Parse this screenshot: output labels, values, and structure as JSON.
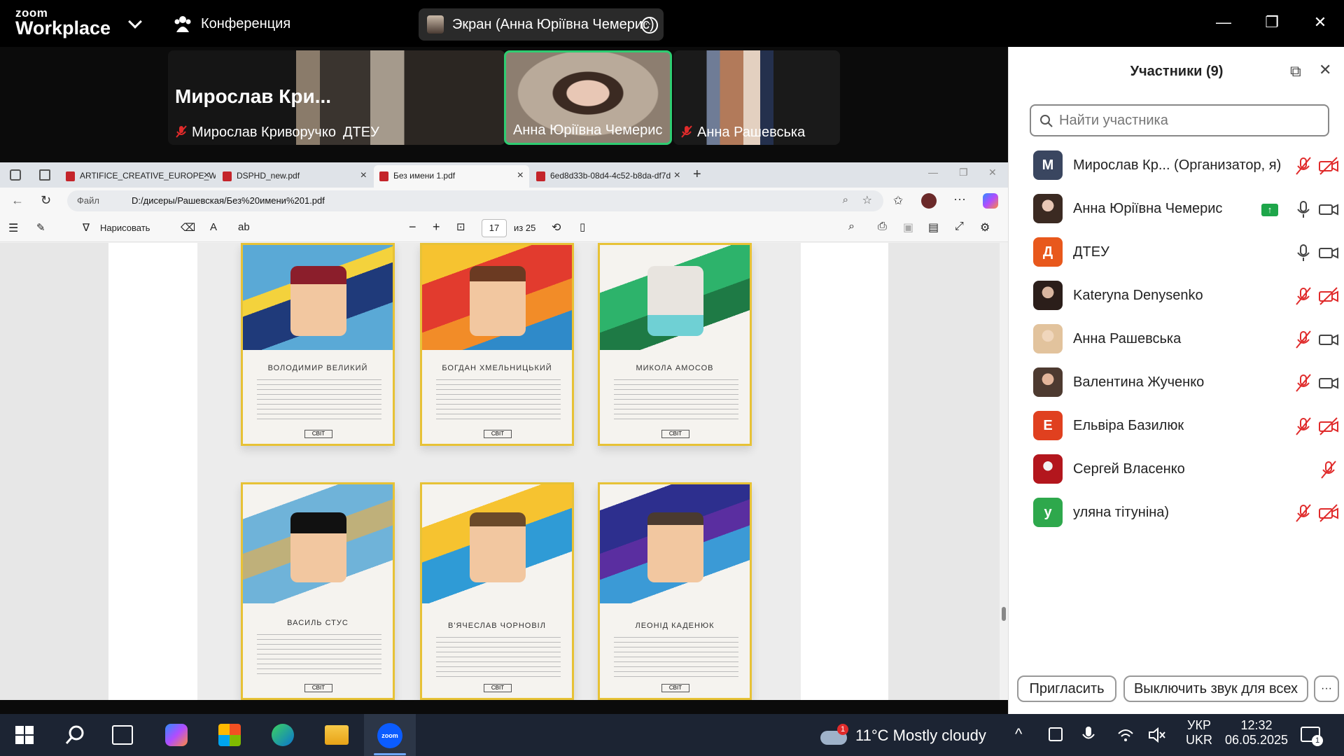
{
  "topbar": {
    "logo_small": "zoom",
    "logo_big": "Workplace",
    "conference_label": "Конференция",
    "screen_share_label": "Экран (Анна Юріївна Чемерис)"
  },
  "video_tiles": [
    {
      "name_big": "Мирослав  Кри...",
      "name": "Мирослав Криворучко"
    },
    {
      "name": "ДТЕУ"
    },
    {
      "name": "Анна Юріївна Чемерис"
    },
    {
      "name": "Анна Рашевська"
    }
  ],
  "browser": {
    "tabs": [
      {
        "title": "ARTIFICE_CREATIVE_EUROPE_WP"
      },
      {
        "title": "DSPHD_new.pdf"
      },
      {
        "title": "Без имени 1.pdf"
      },
      {
        "title": "6ed8d33b-08d4-4c52-b8da-df7d"
      }
    ],
    "address_label": "Файл",
    "address_url": "D:/дисеры/Рашевская/Без%20имени%201.pdf",
    "pdf_toolbar": {
      "draw_label": "Нарисовать",
      "page_current": "17",
      "page_total": "из 25"
    }
  },
  "cards": [
    {
      "caption": "ВОЛОДИМИР ВЕЛИКИЙ"
    },
    {
      "caption": "БОГДАН ХМЕЛЬНИЦЬКИЙ"
    },
    {
      "caption": "МИКОЛА АМОСОВ"
    },
    {
      "caption": "ВАСИЛЬ СТУС"
    },
    {
      "caption": "В'ЯЧЕСЛАВ ЧОРНОВІЛ"
    },
    {
      "caption": "ЛЕОНІД КАДЕНЮК"
    }
  ],
  "card_logo": "СВІТ",
  "participants": {
    "title": "Участники (9)",
    "search_placeholder": "Найти участника",
    "list": [
      {
        "initial": "М",
        "name": "Мирослав Кр...  (Организатор, я)",
        "color": "#3a4660"
      },
      {
        "initial": "",
        "name": "Анна Юріївна Чемерис",
        "color": "#5a4a42"
      },
      {
        "initial": "Д",
        "name": "ДТЕУ",
        "color": "#e8581c"
      },
      {
        "initial": "",
        "name": "Kateryna Denysenko",
        "color": "#4b3a36"
      },
      {
        "initial": "",
        "name": "Анна Рашевська",
        "color": "#e2c39d"
      },
      {
        "initial": "",
        "name": "Валентина Жученко",
        "color": "#7a5d4f"
      },
      {
        "initial": "Е",
        "name": "Ельвіра Базилюк",
        "color": "#e0401f"
      },
      {
        "initial": "",
        "name": "Сергей Власенко",
        "color": "#b3161d"
      },
      {
        "initial": "у",
        "name": "уляна тітуніна)",
        "color": "#2ea84c"
      }
    ],
    "invite_label": "Пригласить",
    "mute_all_label": "Выключить звук для всех"
  },
  "taskbar": {
    "weather": "11°C  Mostly cloudy",
    "weather_badge": "1",
    "lang_top": "УКР",
    "lang_bottom": "UKR",
    "time": "12:32",
    "date": "06.05.2025",
    "notif_count": "1"
  },
  "colors": {
    "active_speaker": "#2ecc71",
    "mic_off_red": "#e02b2b",
    "zoom_blue": "#0b5cff"
  }
}
